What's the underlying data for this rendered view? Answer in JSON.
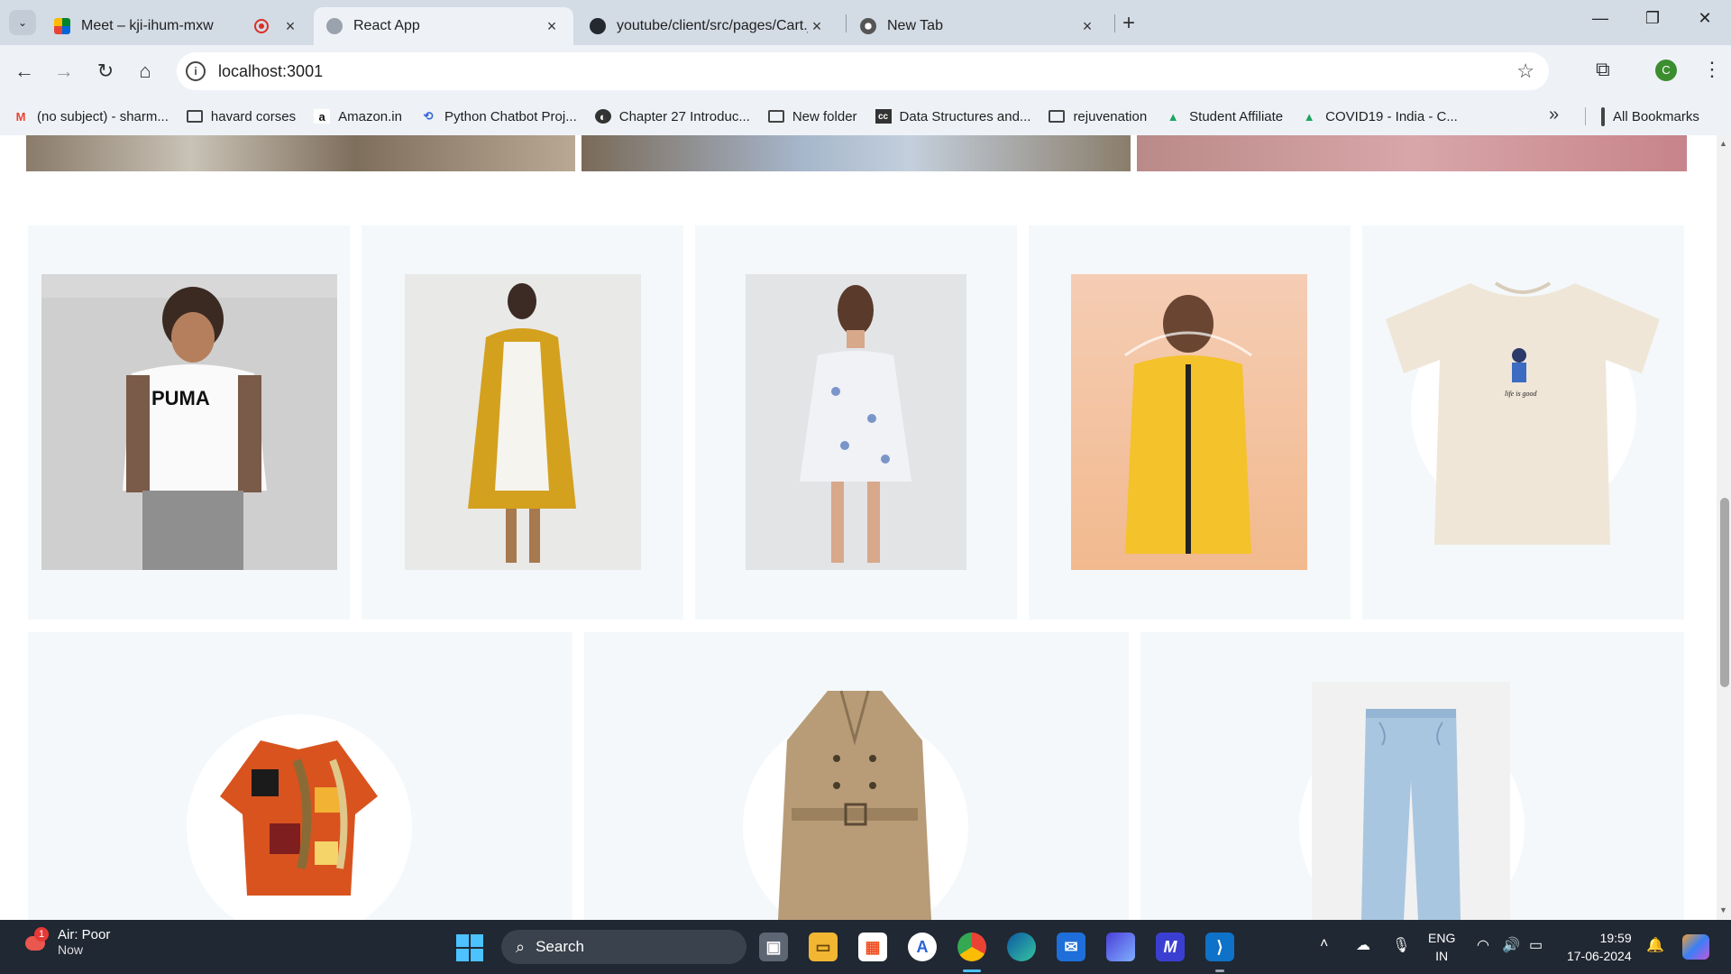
{
  "browser": {
    "tabs": [
      {
        "title": "Meet – kji-ihum-mxw",
        "favicon": "google-meet-icon",
        "recording": true
      },
      {
        "title": "React App",
        "favicon": "globe-icon",
        "active": true
      },
      {
        "title": "youtube/client/src/pages/Cart.j",
        "favicon": "github-icon"
      },
      {
        "title": "New Tab",
        "favicon": "chrome-icon"
      }
    ],
    "url": "localhost:3001",
    "profile_initial": "C",
    "bookmarks": [
      {
        "label": "(no subject) - sharm...",
        "icon": "gmail-icon"
      },
      {
        "label": "havard corses",
        "icon": "folder-icon"
      },
      {
        "label": "Amazon.in",
        "icon": "amazon-icon"
      },
      {
        "label": "Python Chatbot Proj...",
        "icon": "link-icon"
      },
      {
        "label": "Chapter 27 Introduc...",
        "icon": "globe-icon"
      },
      {
        "label": "New folder",
        "icon": "folder-icon"
      },
      {
        "label": "Data Structures and...",
        "icon": "cc-icon"
      },
      {
        "label": "rejuvenation",
        "icon": "folder-icon"
      },
      {
        "label": "Student Affiliate",
        "icon": "drive-icon"
      },
      {
        "label": "COVID19 - India - C...",
        "icon": "drive-icon"
      }
    ],
    "all_bookmarks": "All Bookmarks"
  },
  "page": {
    "products_row1": [
      {
        "name": "puma-white-tshirt",
        "color": "#c9c9c9"
      },
      {
        "name": "mustard-coat",
        "color": "#d4a11f"
      },
      {
        "name": "floral-dress",
        "color": "#dfe4ec"
      },
      {
        "name": "yellow-raincoat",
        "color": "#f2c44a"
      },
      {
        "name": "cream-tshirt",
        "color": "#efe6d8"
      }
    ],
    "products_row2": [
      {
        "name": "printed-shirt",
        "color": "#c9481c"
      },
      {
        "name": "trench-coat",
        "color": "#b89c77"
      },
      {
        "name": "light-jeans",
        "color": "#a9c6e0"
      }
    ]
  },
  "taskbar": {
    "weather_title": "Air: Poor",
    "weather_sub": "Now",
    "weather_badge": "1",
    "search_label": "Search",
    "lang_top": "ENG",
    "lang_bottom": "IN",
    "time": "19:59",
    "date": "17-06-2024"
  }
}
